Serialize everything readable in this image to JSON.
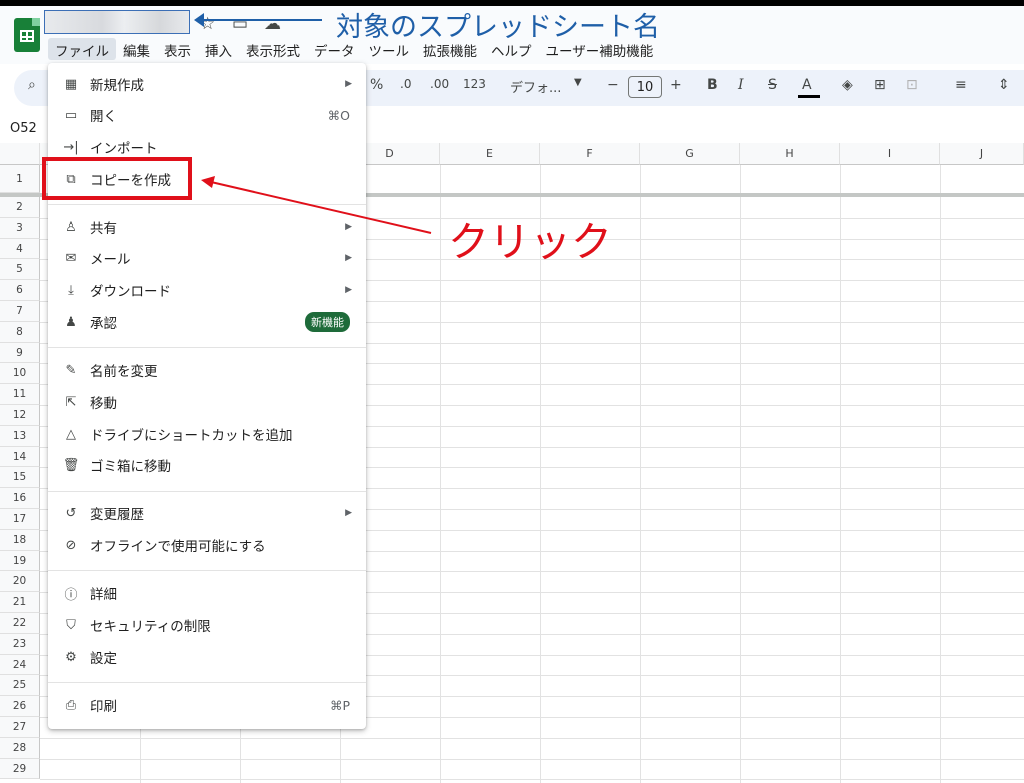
{
  "header": {
    "annotation_title": "対象のスプレッドシート名",
    "menubar": [
      "ファイル",
      "編集",
      "表示",
      "挿入",
      "表示形式",
      "データ",
      "ツール",
      "拡張機能",
      "ヘルプ",
      "ユーザー補助機能"
    ],
    "icons": [
      "star-icon",
      "move-folder-icon",
      "cloud-status-icon"
    ]
  },
  "toolbar": {
    "percent": "%",
    "dec_decrease": ".0",
    "dec_increase": ".00",
    "number_format": "123",
    "font": "デフォ...",
    "font_size": "10",
    "minus": "−",
    "plus": "+",
    "bold": "B",
    "italic": "I",
    "strike": "S",
    "text_color": "A"
  },
  "namebox": "O52",
  "columns": [
    "D",
    "E",
    "F",
    "G",
    "H",
    "I",
    "J"
  ],
  "rows": [
    "1",
    "2",
    "3",
    "4",
    "5",
    "6",
    "7",
    "8",
    "9",
    "10",
    "11",
    "12",
    "13",
    "14",
    "15",
    "16",
    "17",
    "18",
    "19",
    "20",
    "21",
    "22",
    "23",
    "24",
    "25",
    "26",
    "27",
    "28",
    "29"
  ],
  "file_menu": {
    "new": "新規作成",
    "open": "開く",
    "open_shortcut": "⌘O",
    "import": "インポート",
    "copy": "コピーを作成",
    "share": "共有",
    "email": "メール",
    "download": "ダウンロード",
    "approve": "承認",
    "approve_badge": "新機能",
    "rename": "名前を変更",
    "move": "移動",
    "shortcut": "ドライブにショートカットを追加",
    "trash": "ゴミ箱に移動",
    "history": "変更履歴",
    "offline": "オフラインで使用可能にする",
    "details": "詳細",
    "security": "セキュリティの制限",
    "settings": "設定",
    "print": "印刷",
    "print_shortcut": "⌘P"
  },
  "annotation_click": "クリック",
  "colors": {
    "annotation_blue": "#1f5fa8",
    "annotation_red": "#e0101a",
    "sheets_green": "#188038"
  }
}
